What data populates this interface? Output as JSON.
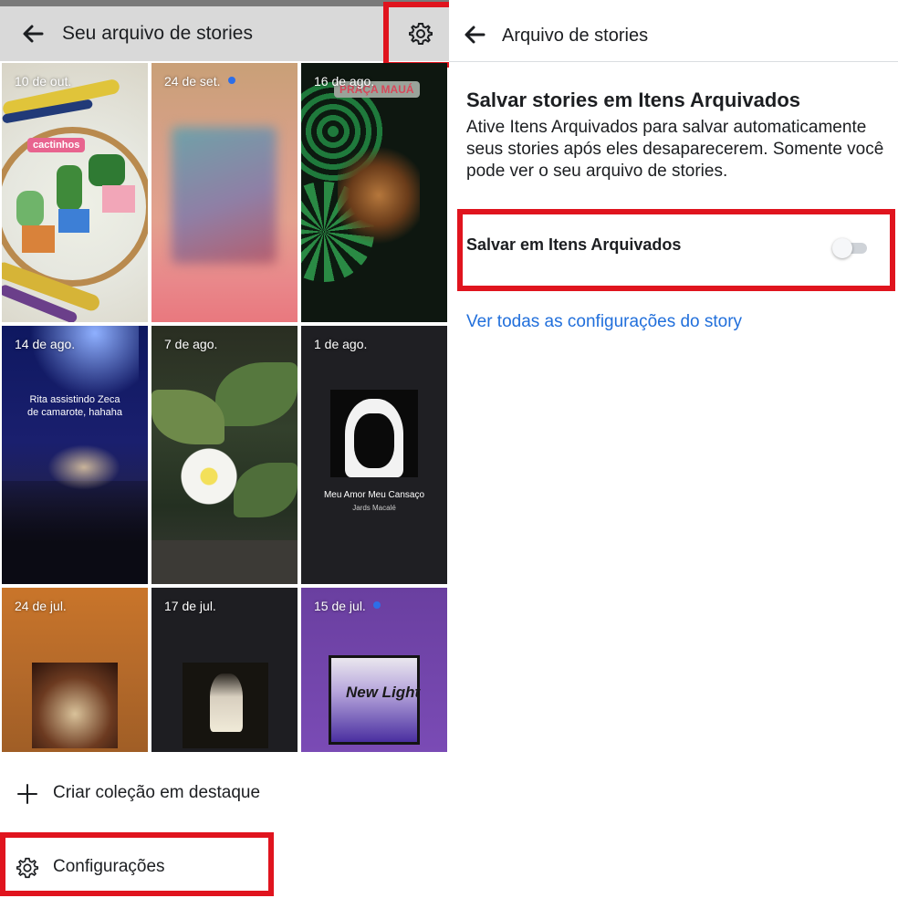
{
  "left_panel": {
    "title": "Seu arquivo de stories",
    "back_icon": "arrow-left-icon",
    "settings_icon": "gear-icon",
    "stories": [
      {
        "date": "10 de out.",
        "new": false,
        "sticker": "cactinhos"
      },
      {
        "date": "24 de set.",
        "new": true
      },
      {
        "date": "16 de ago.",
        "new": false,
        "sticker": "PRAÇA MAUÁ"
      },
      {
        "date": "14 de ago.",
        "new": false,
        "overlay_text": "Rita assistindo Zeca de camarote, hahaha"
      },
      {
        "date": "7 de ago.",
        "new": false
      },
      {
        "date": "1 de ago.",
        "new": false,
        "song_title": "Meu Amor Meu Cansaço",
        "song_artist": "Jards Macalé"
      },
      {
        "date": "24 de jul.",
        "new": false
      },
      {
        "date": "17 de jul.",
        "new": false
      },
      {
        "date": "15 de jul.",
        "new": true,
        "album_text": "New Light"
      }
    ],
    "create_highlight": {
      "icon": "plus-icon",
      "label": "Criar coleção em destaque"
    },
    "settings_item": {
      "icon": "gear-icon",
      "label": "Configurações"
    }
  },
  "right_panel": {
    "title": "Arquivo de stories",
    "back_icon": "arrow-left-icon",
    "section_title": "Salvar stories em Itens Arquivados",
    "section_description": "Ative Itens Arquivados para salvar automaticamente seus stories após eles desaparecerem. Somente você pode ver o seu arquivo de stories.",
    "toggle": {
      "label": "Salvar em Itens Arquivados",
      "on": false
    },
    "link": "Ver todas as configurações do story"
  },
  "colors": {
    "highlight": "#e0141e",
    "link": "#216fdb",
    "new_dot": "#2d6ee8",
    "header_gray": "#d9d9d9"
  }
}
